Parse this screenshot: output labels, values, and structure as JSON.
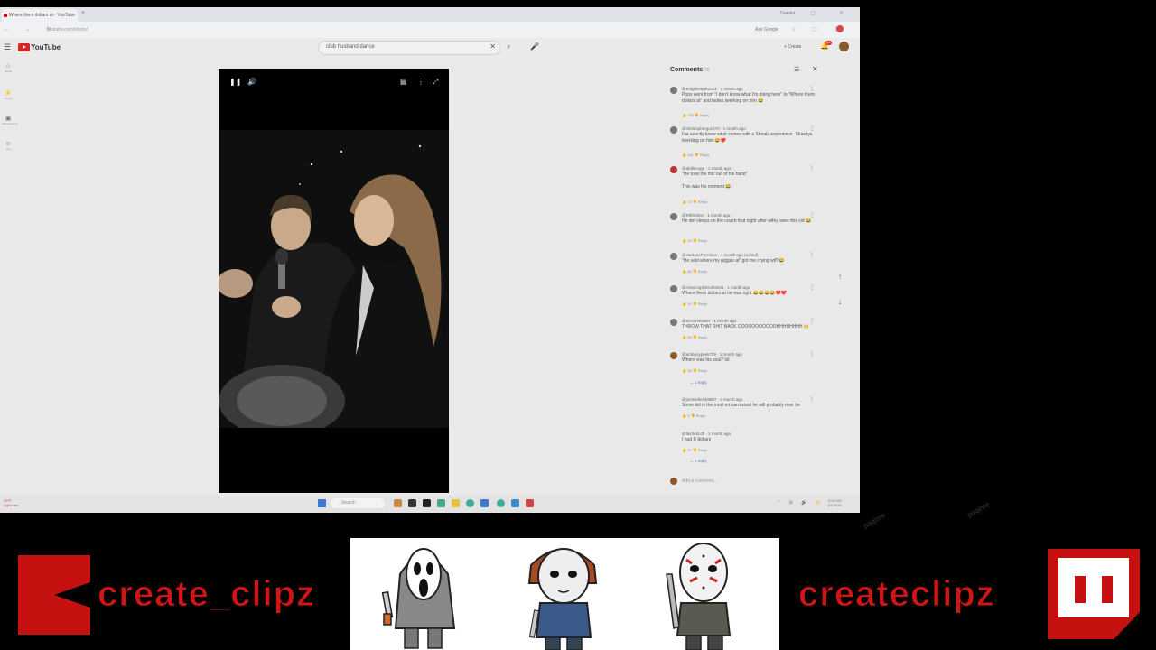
{
  "browser": {
    "tab_title": "Where them dollars at - YouTube",
    "new_tab": "+",
    "gemini_label": "Gemini",
    "window_controls": "— ▢ ✕",
    "nav": "← → ↻",
    "url": "youtube.com/shorts/",
    "ask_google": "Ask Google",
    "right_icons": "☆ ⬚ ⋮"
  },
  "youtube": {
    "menu_icon": "☰",
    "logo_text": "YouTube",
    "search_value": "club husband dance",
    "search_clear": "✕",
    "search_icon": "⌕",
    "mic_icon": "🎤",
    "create_label": "+ Create",
    "bell_icon": "🔔",
    "bell_badge": "9+"
  },
  "sidebar": {
    "items": [
      {
        "icon": "⌂",
        "label": "Home"
      },
      {
        "icon": "⚡",
        "label": "Shorts"
      },
      {
        "icon": "▣",
        "label": "Subscriptions"
      },
      {
        "icon": "☺",
        "label": "You"
      }
    ]
  },
  "player": {
    "pause_icon": "❚❚",
    "volume_icon": "🔊",
    "captions_icon": "▤",
    "more_icon": "⋮",
    "fullscreen_icon": "⤢"
  },
  "comments": {
    "title": "Comments",
    "count": "76",
    "sort_icon": "☰",
    "close_icon": "✕",
    "like_icon": "👍",
    "dislike_icon": "👎",
    "reply_label": "Reply",
    "dots_icon": "⋮",
    "items": [
      {
        "user": "@KnightHawk2021 · 1 month ago",
        "text": "Pops went from \"I don't know what I'm doing here\" to \"Where them dollars at\" and ladies twerking on him 😂",
        "likes": "726"
      },
      {
        "user": "@christopherguz270 · 1 month ago",
        "text": "I've exactly knew what comes with a Shoals experience. Shawtys twerking on him 😂❤️",
        "likes": "141"
      },
      {
        "user": "@ahillenoge · 1 month ago",
        "text": "\"He took the mic out of his hand\"\n\nThis was his moment 😂",
        "likes": "17"
      },
      {
        "user": "@RiftStriker · 1 month ago",
        "text": "He def sleeps on the couch that night after wifey sees this vid 😂",
        "likes": "12"
      },
      {
        "user": "@JordansPreAlexa · 1 month ago (edited)",
        "text": "\"He said where my niggas at\" got me crying wtf?😂",
        "likes": "45"
      },
      {
        "user": "@Amercophstruth5445 · 1 month ago",
        "text": "Where them dollars at he was right 😂😂😂😂❤️❤️",
        "likes": "10"
      },
      {
        "user": "@mcconelaster · 1 month ago",
        "text": "THROW THAT SHIT BACK OOOOOOOOOOOHHHHHHHH 🙌",
        "likes": "15"
      },
      {
        "user": "@anthonypeek729 · 1 month ago",
        "text": "Where was his soul? lol",
        "likes": "16"
      },
      {
        "user": "@jonmkirkrick5887 · 1 month ago",
        "text": "Some kid is the most embarrassed he will probably ever be",
        "likes": "4"
      },
      {
        "user": "@fairfield.dfl · 1 month ago",
        "text": "I had R dollars",
        "likes": "37"
      }
    ],
    "replies_1": "⌄ 1 reply",
    "replies_2": "⌄ 1 reply",
    "add_placeholder": "Add a comment..."
  },
  "scroll": {
    "up": "↑",
    "down": "↓"
  },
  "taskbar": {
    "left_text": "29°F\nLight rain",
    "search_placeholder": "Search",
    "tray": "⌃ ⊞ 🔊 ⚡",
    "time": "3:25 AM",
    "date": "1/1/2024"
  },
  "overlay": {
    "left_text": "create_clipz",
    "right_text": "createclipz",
    "watermark": "paqiree"
  },
  "colors": {
    "brand_red": "#c61111",
    "youtube_red": "#dd2222"
  }
}
